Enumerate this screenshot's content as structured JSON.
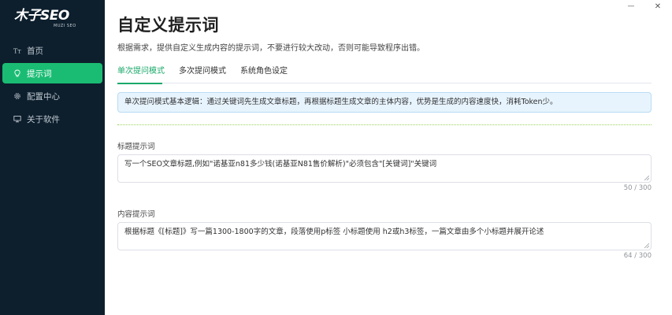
{
  "app": {
    "logo_main": "木子SEO",
    "logo_sub": "MUZI SEO"
  },
  "sidebar": {
    "items": [
      {
        "label": "首页",
        "icon": "text-format-icon",
        "active": false
      },
      {
        "label": "提示词",
        "icon": "lightbulb-icon",
        "active": true
      },
      {
        "label": "配置中心",
        "icon": "gear-icon",
        "active": false
      },
      {
        "label": "关于软件",
        "icon": "monitor-icon",
        "active": false
      }
    ]
  },
  "window": {
    "minimize_glyph": "—",
    "close_glyph": "✕"
  },
  "page": {
    "title": "自定义提示词",
    "description": "根据需求，提供自定义生成内容的提示词，不要进行较大改动，否则可能导致程序出错。"
  },
  "tabs": [
    {
      "label": "单次提问模式",
      "active": true
    },
    {
      "label": "多次提问模式",
      "active": false
    },
    {
      "label": "系统角色设定",
      "active": false
    }
  ],
  "info": {
    "text": "单次提问模式基本逻辑：通过关键词先生成文章标题，再根据标题生成文章的主体内容，优势是生成的内容速度快，消耗Token少。"
  },
  "fields": {
    "title_prompt": {
      "label": "标题提示词",
      "value": "写一个SEO文章标题,例如\"诺基亚n81多少钱(诺基亚N81售价解析)\"必须包含\"[关键词]\"关键词",
      "counter": "50 / 300"
    },
    "content_prompt": {
      "label": "内容提示词",
      "value": "根据标题《[标题]》写一篇1300-1800字的文章，段落使用p标签 小标题使用 h2或h3标签，一篇文章由多个小标题并展开论述",
      "counter": "64 / 300"
    }
  },
  "colors": {
    "sidebar_bg": "#0d1f2d",
    "accent": "#1abc73",
    "info_bg": "#e8f4fd"
  }
}
